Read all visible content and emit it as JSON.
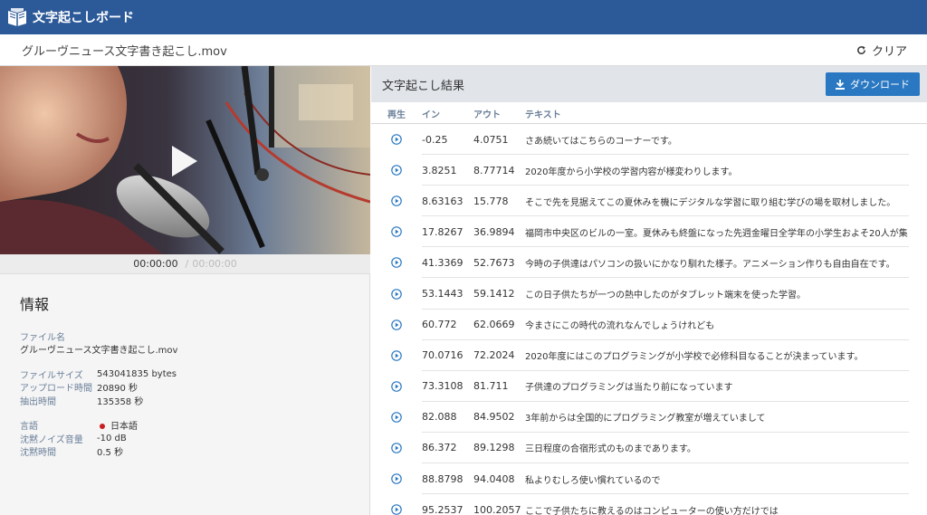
{
  "app": {
    "title": "文字起こしボード"
  },
  "file": {
    "name": "グルーヴニュース文字書き起こし.mov"
  },
  "toolbar": {
    "clear_label": "クリア"
  },
  "player": {
    "current_time": "00:00:00",
    "separator": "/",
    "total_time": "00:00:00"
  },
  "info": {
    "title": "情報",
    "filename_label": "ファイル名",
    "filename_value": "グルーヴニュース文字書き起こし.mov",
    "filesize_label": "ファイルサイズ",
    "filesize_value": "543041835 bytes",
    "upload_label": "アップロード時間",
    "upload_value": "20890 秒",
    "extract_label": "抽出時間",
    "extract_value": "135358 秒",
    "language_label": "言語",
    "language_value": "日本語",
    "noise_label": "沈黙ノイズ音量",
    "noise_value": "-10 dB",
    "silence_label": "沈黙時間",
    "silence_value": "0.5 秒"
  },
  "results": {
    "title": "文字起こし結果",
    "download_label": "ダウンロード",
    "columns": {
      "play": "再生",
      "in": "イン",
      "out": "アウト",
      "text": "テキスト"
    },
    "rows": [
      {
        "in": "-0.25",
        "out": "4.0751",
        "text": "さあ続いてはこちらのコーナーです。"
      },
      {
        "in": "3.8251",
        "out": "8.77714",
        "text": "2020年度から小学校の学習内容が様変わりします。"
      },
      {
        "in": "8.63163",
        "out": "15.778",
        "text": "そこで先を見据えてこの夏休みを機にデジタルな学習に取り組む学びの場を取材しました。"
      },
      {
        "in": "17.8267",
        "out": "36.9894",
        "text": "福岡市中央区のビルの一室。夏休みも終盤になった先週金曜日全学年の小学生およそ20人が集"
      },
      {
        "in": "41.3369",
        "out": "52.7673",
        "text": "今時の子供達はパソコンの扱いにかなり馴れた様子。アニメーション作りも自由自在です。"
      },
      {
        "in": "53.1443",
        "out": "59.1412",
        "text": "この日子供たちが一つの熱中したのがタブレット端末を使った学習。"
      },
      {
        "in": "60.772",
        "out": "62.0669",
        "text": "今まさにこの時代の流れなんでしょうけれども"
      },
      {
        "in": "70.0716",
        "out": "72.2024",
        "text": "2020年度にはこのプログラミングが小学校で必修科目なることが決まっています。"
      },
      {
        "in": "73.3108",
        "out": "81.711",
        "text": "子供達のプログラミングは当たり前になっています"
      },
      {
        "in": "82.088",
        "out": "84.9502",
        "text": "3年前からは全国的にプログラミング教室が増えていまして"
      },
      {
        "in": "86.372",
        "out": "89.1298",
        "text": "三日程度の合宿形式のものまであります。"
      },
      {
        "in": "88.8798",
        "out": "94.0408",
        "text": "私よりむしろ使い慣れているので"
      },
      {
        "in": "95.2537",
        "out": "100.2057",
        "text": "ここで子供たちに教えるのはコンピューターの使い方だけでは"
      }
    ]
  },
  "icons": {
    "logo": "book-logo-icon",
    "clear": "refresh-icon",
    "download": "download-icon",
    "play": "play-circle-icon",
    "video_play": "play-icon"
  },
  "colors": {
    "topbar": "#2c5a99",
    "accent": "#2a78c2",
    "language_dot": "#c8201e"
  }
}
